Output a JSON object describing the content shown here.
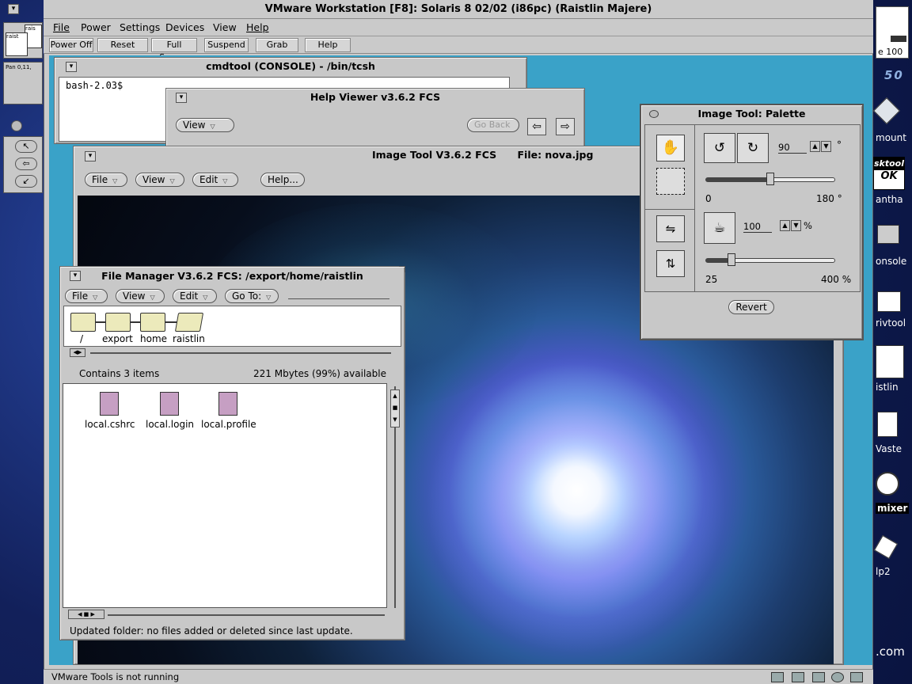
{
  "host": {
    "left_panel": {
      "pager_label_1": "rais",
      "pager_label_2": "raist",
      "pan_text": "Pan 0,11,"
    },
    "right_panel": {
      "meter_value": "100",
      "meter_prefix": "e",
      "clock_text": "50",
      "items": [
        {
          "label": "mount"
        },
        {
          "label": "antha",
          "badge_top": "sktool",
          "badge_bottom": "OK"
        },
        {
          "label": "onsole"
        },
        {
          "label": "rivtool"
        },
        {
          "label": "istlin"
        },
        {
          "label": "Vaste"
        },
        {
          "label": "mixer"
        },
        {
          "label": "lp2"
        }
      ],
      "domain_suffix": ".com"
    }
  },
  "vmware": {
    "title": "VMware Workstation [F8]: Solaris 8 02/02 (i86pc) (Raistlin Majere)",
    "menu": [
      "File",
      "Power",
      "Settings",
      "Devices",
      "View",
      "Help"
    ],
    "toolbar": [
      "Power Off",
      "Reset",
      "Full Screen",
      "Suspend",
      "Grab",
      "Help"
    ],
    "status": "VMware Tools is not running"
  },
  "cmdtool": {
    "title": "cmdtool (CONSOLE) - /bin/tcsh",
    "prompt": "bash-2.03$"
  },
  "help_viewer": {
    "title": "Help Viewer v3.6.2 FCS",
    "view_menu": "View",
    "go_back": "Go Back"
  },
  "image_tool": {
    "title": "Image Tool V3.6.2 FCS",
    "file_label": "File:  nova.jpg",
    "menus": [
      "File",
      "View",
      "Edit"
    ],
    "help": "Help..."
  },
  "palette": {
    "title": "Image Tool:  Palette",
    "rotate_value": "90",
    "rotate_unit": "°",
    "rotate_min": "0",
    "rotate_max": "180 °",
    "rotate_fraction": 0.5,
    "zoom_value": "100",
    "zoom_unit": "%",
    "zoom_min": "25",
    "zoom_max": "400 %",
    "zoom_fraction": 0.2,
    "revert": "Revert"
  },
  "file_manager": {
    "title": "File Manager V3.6.2 FCS: /export/home/raistlin",
    "menus": [
      "File",
      "View",
      "Edit",
      "Go To:"
    ],
    "path": [
      "/",
      "export",
      "home",
      "raistlin"
    ],
    "contains": "Contains 3 items",
    "available": "221 Mbytes (99%) available",
    "files": [
      "local.cshrc",
      "local.login",
      "local.profile"
    ],
    "status": "Updated folder:  no files added or deleted since last update."
  }
}
